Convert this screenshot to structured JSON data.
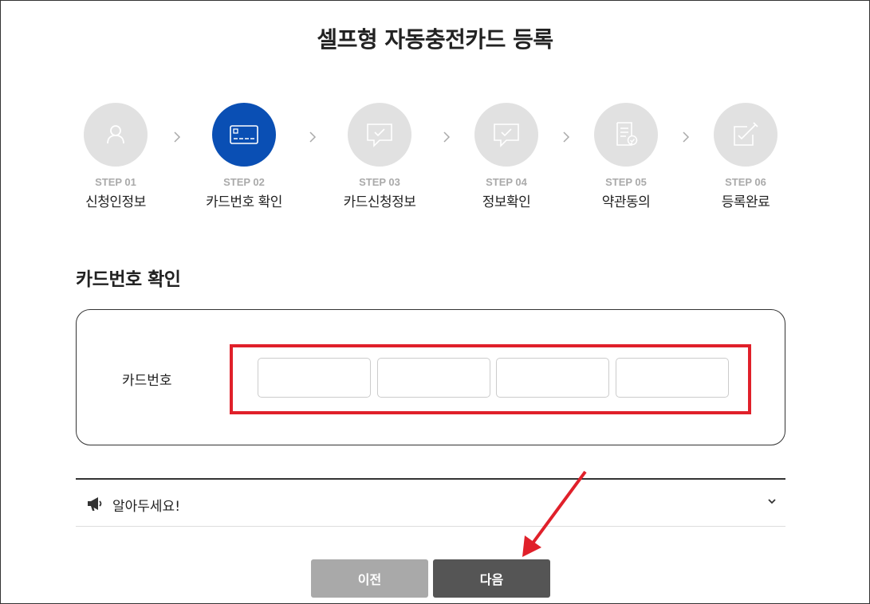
{
  "title": "셀프형 자동충전카드 등록",
  "steps": [
    {
      "num": "STEP 01",
      "label": "신청인정보",
      "icon": "person-icon",
      "active": false
    },
    {
      "num": "STEP 02",
      "label": "카드번호 확인",
      "icon": "credit-card-icon",
      "active": true
    },
    {
      "num": "STEP 03",
      "label": "카드신청정보",
      "icon": "chat-check-icon",
      "active": false
    },
    {
      "num": "STEP 04",
      "label": "정보확인",
      "icon": "chat-check-icon",
      "active": false
    },
    {
      "num": "STEP 05",
      "label": "약관동의",
      "icon": "document-check-icon",
      "active": false
    },
    {
      "num": "STEP 06",
      "label": "등록완료",
      "icon": "edit-check-icon",
      "active": false
    }
  ],
  "section_title": "카드번호 확인",
  "card_form": {
    "label": "카드번호",
    "inputs": [
      "",
      "",
      "",
      ""
    ]
  },
  "notice": {
    "text": "알아두세요!",
    "icon": "megaphone-icon"
  },
  "buttons": {
    "prev": "이전",
    "next": "다음"
  },
  "colors": {
    "active_step": "#0a4fb4",
    "inactive_step": "#e1e1e1",
    "highlight": "#e0202a",
    "prev_button": "#a9a9a9",
    "next_button": "#555555"
  }
}
